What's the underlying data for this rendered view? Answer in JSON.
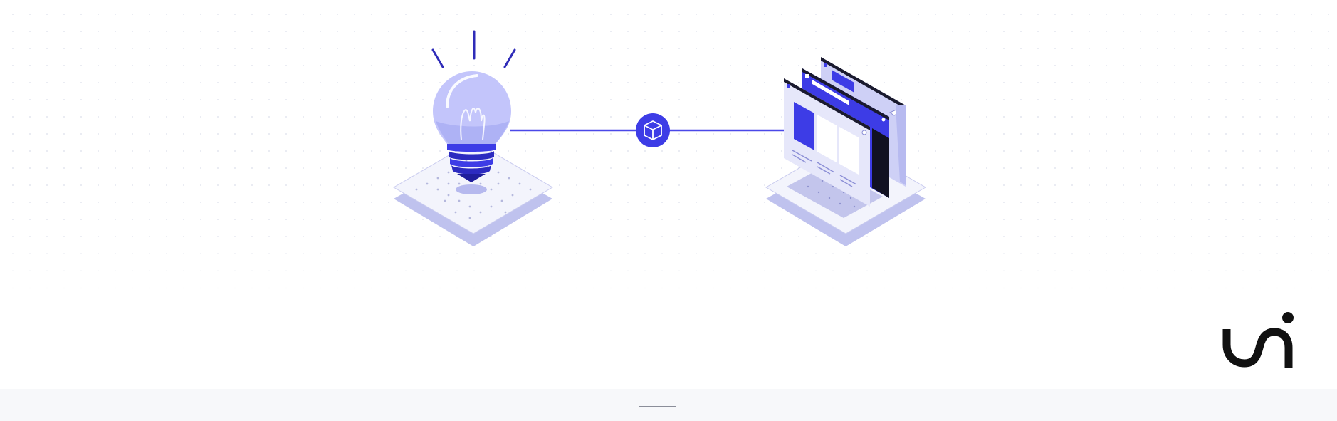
{
  "colors": {
    "accent": "#3d3ce6",
    "accent_light": "#c4c6fb",
    "platform_shadow": "#bfc2ee",
    "logo": "#111111",
    "footer_bg": "#f7f8fa",
    "footer_handle": "#8b8e99"
  },
  "illustration": {
    "left_item": "lightbulb-icon",
    "connector_node": "cube-icon",
    "right_item": "browser-windows-icon"
  },
  "brand": {
    "logo": "brand-logo-icon"
  },
  "footer": {
    "handle": "drag-handle"
  }
}
